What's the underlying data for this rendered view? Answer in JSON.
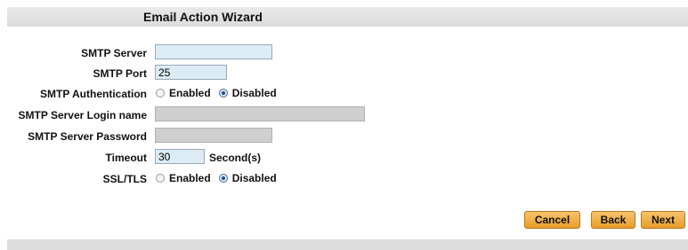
{
  "wizard": {
    "title": "Email Action Wizard"
  },
  "form": {
    "smtp_server": {
      "label": "SMTP Server",
      "value": ""
    },
    "smtp_port": {
      "label": "SMTP Port",
      "value": "25"
    },
    "smtp_auth": {
      "label": "SMTP Authentication",
      "options": [
        "Enabled",
        "Disabled"
      ],
      "selected": "Disabled"
    },
    "login_name": {
      "label": "SMTP Server Login name",
      "value": "",
      "disabled": true
    },
    "password": {
      "label": "SMTP Server Password",
      "value": "",
      "disabled": true
    },
    "timeout": {
      "label": "Timeout",
      "value": "30",
      "unit": "Second(s)"
    },
    "ssl_tls": {
      "label": "SSL/TLS",
      "options": [
        "Enabled",
        "Disabled"
      ],
      "selected": "Disabled"
    }
  },
  "buttons": {
    "cancel": "Cancel",
    "back": "Back",
    "next": "Next"
  },
  "colors": {
    "button_accent": "#e89d28",
    "input_bg": "#dcecf4",
    "disabled_bg": "#cfcfcf"
  }
}
